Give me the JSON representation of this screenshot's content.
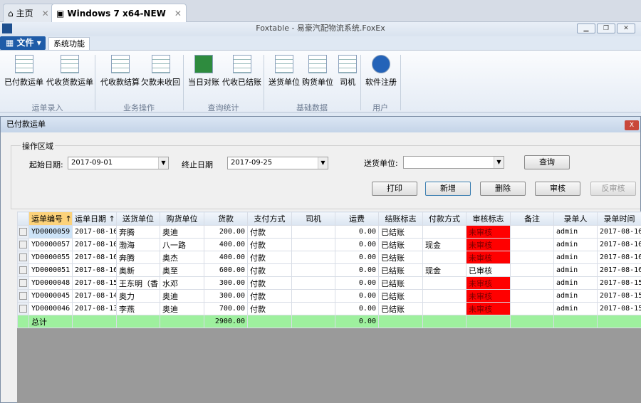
{
  "browser_tabs": [
    {
      "label": "主页",
      "icon": "home-icon"
    },
    {
      "label": "Windows 7 x64-NEW",
      "icon": "vm-icon"
    }
  ],
  "window": {
    "title": "Foxtable - 易豪汽配物流系统.FoxEx",
    "controls": [
      "minimize",
      "restore",
      "close"
    ]
  },
  "ribbon": {
    "file_label": "文件",
    "tab": "系统功能",
    "groups": [
      {
        "label": "运单录入",
        "buttons": [
          "已付款运单",
          "代收货款运单"
        ]
      },
      {
        "label": "业务操作",
        "buttons": [
          "代收款结算",
          "欠款未收回"
        ]
      },
      {
        "label": "查询统计",
        "buttons": [
          "当日对账",
          "代收已结账"
        ]
      },
      {
        "label": "基础数据",
        "buttons": [
          "送货单位",
          "购货单位",
          "司机"
        ]
      },
      {
        "label": "用户",
        "buttons": [
          "软件注册"
        ]
      }
    ]
  },
  "child": {
    "title": "已付款运单",
    "close": "X"
  },
  "form": {
    "legend": "操作区域",
    "start_label": "起始日期:",
    "start_value": "2017-09-01",
    "end_label": "终止日期",
    "end_value": "2017-09-25",
    "sender_label": "送货单位:",
    "sender_value": "",
    "query": "查询",
    "print": "打印",
    "add": "新增",
    "delete": "删除",
    "audit": "审核",
    "unaudit": "反审核"
  },
  "grid": {
    "columns": [
      "运单编号 ↑",
      "运单日期 ↑",
      "送货单位",
      "购货单位",
      "货款",
      "支付方式",
      "司机",
      "运费",
      "结账标志",
      "付款方式",
      "审核标志",
      "备注",
      "录单人",
      "录单时间"
    ],
    "rows": [
      [
        "YD0000059",
        "2017-08-16",
        "奔腾",
        "奥迪",
        "200.00",
        "付款",
        "",
        "0.00",
        "已结账",
        "",
        "未审核",
        "",
        "admin",
        "2017-08-16"
      ],
      [
        "YD0000057",
        "2017-08-16",
        "渤海",
        "八一路",
        "400.00",
        "付款",
        "",
        "0.00",
        "已结账",
        "现金",
        "未审核",
        "",
        "admin",
        "2017-08-16"
      ],
      [
        "YD0000055",
        "2017-08-16",
        "奔腾",
        "奥杰",
        "400.00",
        "付款",
        "",
        "0.00",
        "已结账",
        "",
        "未审核",
        "",
        "admin",
        "2017-08-16"
      ],
      [
        "YD0000051",
        "2017-08-16",
        "奥新",
        "奥至",
        "600.00",
        "付款",
        "",
        "0.00",
        "已结账",
        "现金",
        "已审核",
        "",
        "admin",
        "2017-08-16"
      ],
      [
        "YD0000048",
        "2017-08-15",
        "王东明（香",
        "水邓",
        "300.00",
        "付款",
        "",
        "0.00",
        "已结账",
        "",
        "未审核",
        "",
        "admin",
        "2017-08-15"
      ],
      [
        "YD0000045",
        "2017-08-14",
        "奥力",
        "奥迪",
        "300.00",
        "付款",
        "",
        "0.00",
        "已结账",
        "",
        "未审核",
        "",
        "admin",
        "2017-08-15"
      ],
      [
        "YD0000046",
        "2017-08-13",
        "李燕",
        "奥迪",
        "700.00",
        "付款",
        "",
        "0.00",
        "已结账",
        "",
        "未审核",
        "",
        "admin",
        "2017-08-15"
      ]
    ],
    "total": {
      "label": "总计",
      "goods": "2900.00",
      "freight": "0.00"
    },
    "colors": {
      "unaudited": "#ff0000",
      "total_row": "#9ef09e",
      "sorted_header": "#fcd27a"
    }
  }
}
